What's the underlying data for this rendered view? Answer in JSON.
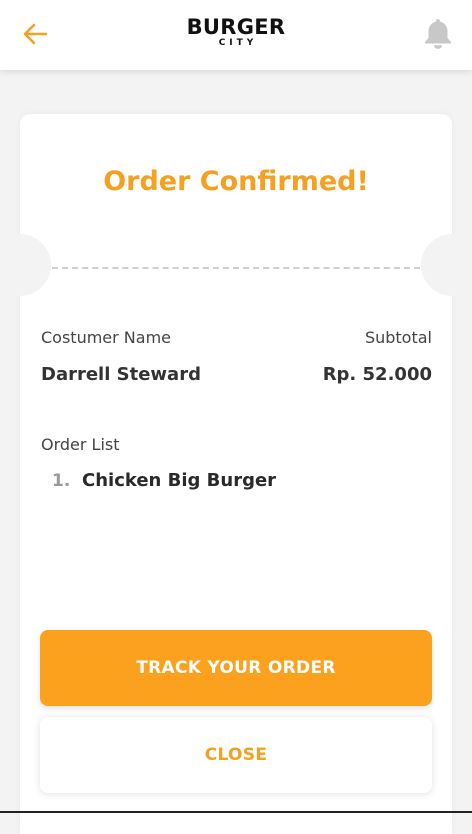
{
  "header": {
    "back_icon": "arrow-left-icon",
    "logo_main": "BURGER",
    "logo_sub": "CITY",
    "notification_icon": "bell-icon"
  },
  "card": {
    "title": "Order Confirmed!",
    "customer_name_label": "Costumer Name",
    "customer_name": "Darrell Steward",
    "subtotal_label": "Subtotal",
    "subtotal": "Rp. 52.000",
    "order_list_label": "Order List",
    "items": [
      {
        "number": "1.",
        "name": "Chicken Big Burger"
      }
    ]
  },
  "actions": {
    "track_label": "TRACK YOUR ORDER",
    "close_label": "CLOSE"
  },
  "colors": {
    "accent": "#fba11e",
    "title": "#f5a020",
    "background": "#f3f3f3"
  }
}
